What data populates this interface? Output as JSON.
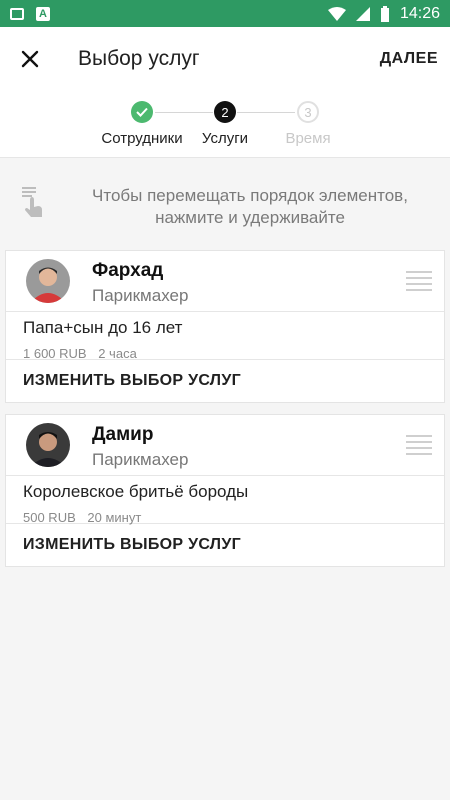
{
  "status_bar": {
    "time": "14:26",
    "left_icons": [
      "image-icon",
      "a-icon"
    ],
    "right_icons": [
      "wifi-icon",
      "signal-icon",
      "battery-icon"
    ]
  },
  "app_bar": {
    "title": "Выбор услуг",
    "next_label": "ДАЛЕЕ"
  },
  "stepper": {
    "steps": [
      {
        "label": "Сотрудники",
        "state": "done",
        "number": ""
      },
      {
        "label": "Услуги",
        "state": "active",
        "number": "2"
      },
      {
        "label": "Время",
        "state": "future",
        "number": "3"
      }
    ]
  },
  "hint": {
    "text": "Чтобы перемещать порядок элементов, нажмите и удерживайте"
  },
  "cards": [
    {
      "name": "Фархад",
      "role": "Парикмахер",
      "service": "Папа+сын до 16 лет",
      "price": "1 600 RUB",
      "duration": "2 часа",
      "action": "ИЗМЕНИТЬ ВЫБОР УСЛУГ"
    },
    {
      "name": "Дамир",
      "role": "Парикмахер",
      "service": "Королевское бритьё бороды",
      "price": "500 RUB",
      "duration": "20 минут",
      "action": "ИЗМЕНИТЬ ВЫБОР УСЛУГ"
    }
  ],
  "colors": {
    "status_bar": "#2e9a63",
    "step_done": "#4cb96f",
    "step_active": "#111111"
  }
}
